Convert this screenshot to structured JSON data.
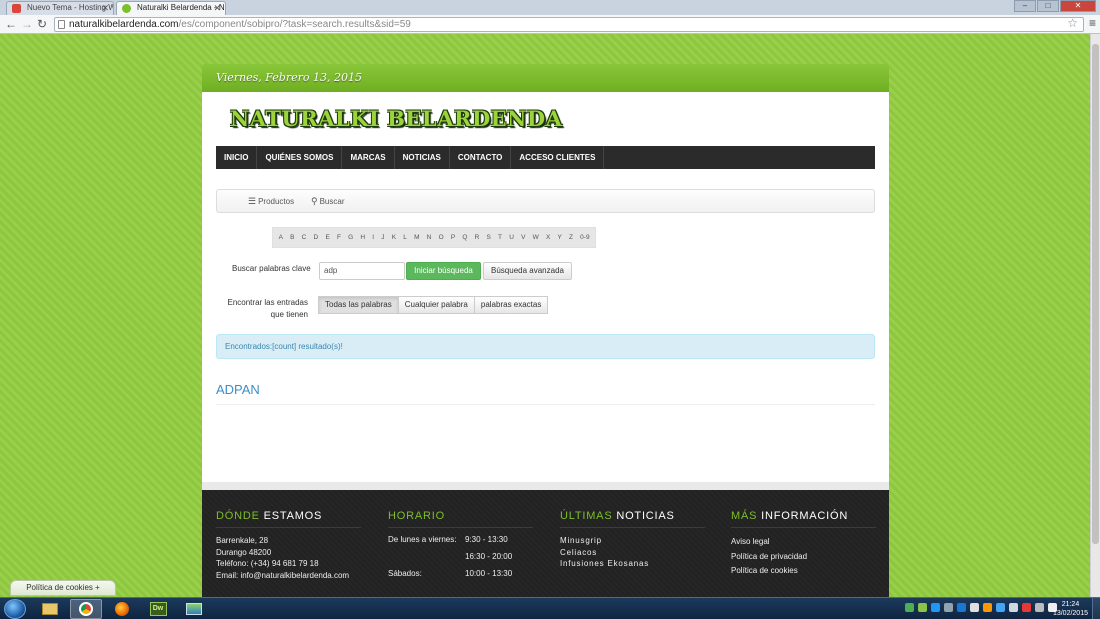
{
  "browser": {
    "tabs": [
      {
        "label": "Nuevo Tema - Hosting W"
      },
      {
        "label": "Naturalki Belardenda - Na"
      }
    ],
    "url_host": "naturalkibelardenda.com",
    "url_path": "/es/component/sobipro/?task=search.results&sid=59"
  },
  "site": {
    "date": "Viernes, Febrero 13, 2015",
    "logo_text": "NATURALKI BELARDENDA",
    "nav": [
      "INICIO",
      "QUIÉNES SOMOS",
      "MARCAS",
      "NOTICIAS",
      "CONTACTO",
      "ACCESO CLIENTES"
    ],
    "subtabs": {
      "products": "Productos",
      "search": "Buscar"
    },
    "alphabet": [
      "A",
      "B",
      "C",
      "D",
      "E",
      "F",
      "G",
      "H",
      "I",
      "J",
      "K",
      "L",
      "M",
      "N",
      "O",
      "P",
      "Q",
      "R",
      "S",
      "T",
      "U",
      "V",
      "W",
      "X",
      "Y",
      "Z",
      "0-9"
    ],
    "search": {
      "keyword_label": "Buscar palabras clave",
      "keyword_value": "adp",
      "search_button": "Iniciar búsqueda",
      "advanced_button": "Búsqueda avanzada",
      "match_label_line1": "Encontrar las entradas",
      "match_label_line2": "que tienen",
      "match_options": [
        "Todas las palabras",
        "Cualquier palabra",
        "palabras exactas"
      ]
    },
    "alert_text": "Encontrados:[count] resultado(s)!",
    "result_title": "ADPAN"
  },
  "footer": {
    "where": {
      "head_green": "DÓNDE",
      "head_white": "ESTAMOS",
      "lines": [
        "Barrenkale, 28",
        "Durango 48200",
        "Teléfono: (+34) 94 681 79 18",
        "Email: info@naturalkibelardenda.com"
      ]
    },
    "hours": {
      "head_green": "HORARIO",
      "rows": [
        {
          "day": "De lunes a viernes:",
          "hours": "9:30 - 13:30"
        },
        {
          "day": "",
          "hours": "16:30 - 20:00"
        },
        {
          "day": "Sábados:",
          "hours": "10:00 - 13:30"
        }
      ]
    },
    "news": {
      "head_green": "ÚLTIMAS",
      "head_white": "NOTICIAS",
      "items": [
        "Minusgrip",
        "Celiacos",
        "Infusiones Ekosanas"
      ]
    },
    "more": {
      "head_green": "MÁS",
      "head_white": "INFORMACIÓN",
      "links": [
        "Aviso legal",
        "Política de privacidad",
        "Política de cookies"
      ]
    }
  },
  "cookie_tab": "Política de cookies +",
  "taskbar": {
    "time": "21:24",
    "date": "13/02/2015",
    "dw_label": "Dw"
  },
  "colors": {
    "accent_green": "#7dbf29",
    "nav_dark": "#2b2b2b",
    "result_blue": "#3a8fc8",
    "alert_bg": "#d9edf7"
  }
}
